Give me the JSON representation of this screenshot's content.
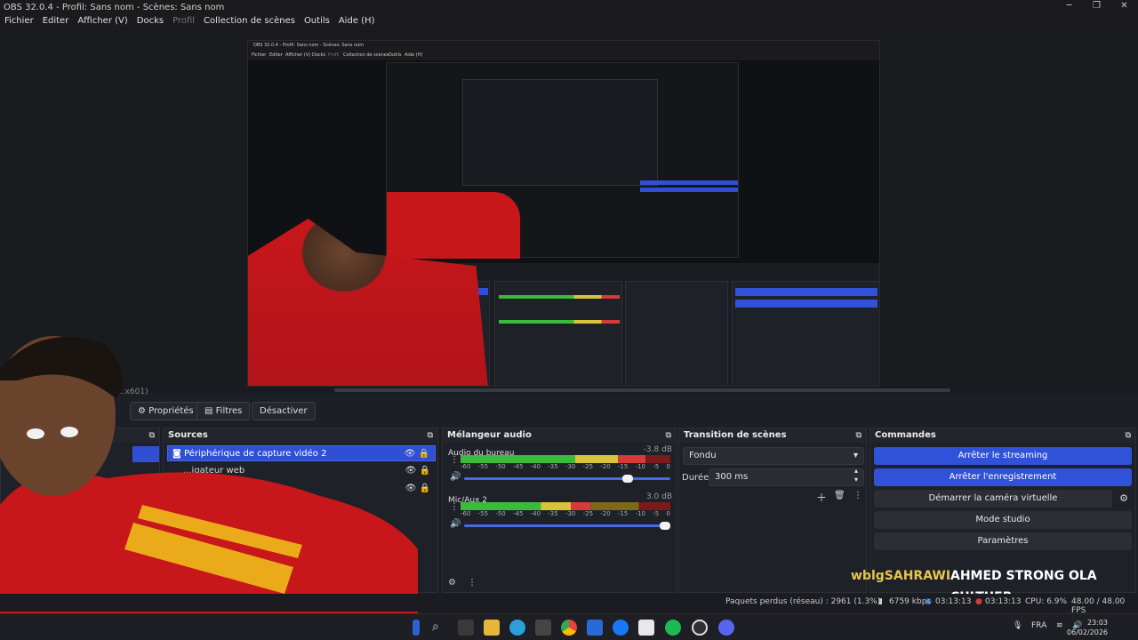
{
  "window": {
    "title": "OBS 32.0.4 - Profil: Sans nom - Scènes: Sans nom",
    "min": "─",
    "max": "❐",
    "close": "✕"
  },
  "menu": [
    "Fichier",
    "Editer",
    "Afficher (V)",
    "Docks",
    "Profil",
    "Collection de scènes",
    "Outils",
    "Aide (H)"
  ],
  "nested_preview": {
    "title": "OBS 32.0.4 - Profil: Sans nom - Scènes: Sans nom",
    "menu": [
      "Fichier",
      "Editer",
      "Afficher (V)",
      "Docks",
      "Profil",
      "Collection de scènes",
      "Outils",
      "Aide (H)"
    ]
  },
  "scene_crumb": "...x601)",
  "toolbar": {
    "properties": "Propriétés",
    "filters": "Filtres",
    "deactivate": "Désactiver"
  },
  "sources": {
    "title": "Sources",
    "items": [
      {
        "label": "Périphérique de capture vidéo 2"
      },
      {
        "label": "...igateur web"
      },
      {
        "label": ""
      }
    ]
  },
  "mixer": {
    "title": "Mélangeur audio",
    "ticks": [
      "-60",
      "-55",
      "-50",
      "-45",
      "-40",
      "-35",
      "-30",
      "-25",
      "-20",
      "-15",
      "-10",
      "-5",
      "0"
    ],
    "channels": [
      {
        "name": "Audio du bureau",
        "db": "-3.8 dB",
        "level": 0.88,
        "volume": 0.82
      },
      {
        "name": "Mic/Aux 2",
        "db": "3.0 dB",
        "level": 0.62,
        "volume": 1.0
      }
    ]
  },
  "transitions": {
    "title": "Transition de scènes",
    "selected": "Fondu",
    "duration_label": "Durée",
    "duration_value": "300 ms"
  },
  "commands": {
    "title": "Commandes",
    "stop_streaming": "Arrêter le streaming",
    "stop_recording": "Arrêter l'enregistrement",
    "virtual_camera": "Démarrer la caméra virtuelle",
    "studio_mode": "Mode studio",
    "settings": "Paramètres"
  },
  "overlay": {
    "user": "wblgSAHRAWI",
    "line1": "AHMED STRONG OLA",
    "line2": "CULTUER"
  },
  "status": {
    "dropped": "Paquets perdus (réseau) : 2961 (1.3%)",
    "bitrate": "6759 kbps",
    "stream_time": "03:13:13",
    "rec_time": "03:13:13",
    "cpu": "CPU: 6.9%",
    "fps": "48.00 / 48.00 FPS"
  },
  "taskbar": {
    "lang": "FRA",
    "time": "23:03",
    "date": "06/02/2026"
  },
  "colors": {
    "accent": "#3052d8",
    "panel": "#1f2128",
    "overlay_yellow": "#e8c64a"
  }
}
